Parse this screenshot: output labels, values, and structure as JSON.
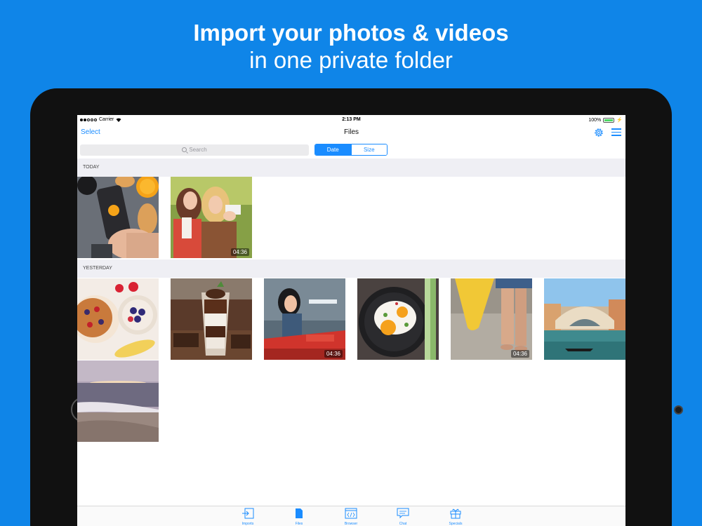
{
  "headline": {
    "line1": "Import your photos & videos",
    "line2": "in one private folder"
  },
  "status": {
    "carrier": "Carrier",
    "time": "2:13 PM",
    "battery": "100%"
  },
  "nav": {
    "select": "Select",
    "title": "Files",
    "icons": [
      "gear-icon",
      "menu-icon"
    ]
  },
  "search": {
    "placeholder": "Search"
  },
  "sort": {
    "date": "Date",
    "size": "Size",
    "selected": "Date"
  },
  "sections": [
    {
      "title": "TODAY",
      "items": [
        {
          "subject": "hand holding phone over breakfast"
        },
        {
          "subject": "two women taking a selfie",
          "duration": "04:36"
        }
      ]
    },
    {
      "title": "YESTERDAY",
      "items": [
        {
          "subject": "granola bowls with berries and bananas"
        },
        {
          "subject": "chocolate parfait dessert"
        },
        {
          "subject": "woman leaning on red car",
          "duration": "04:36"
        },
        {
          "subject": "fried eggs in a pan"
        },
        {
          "subject": "legs with surfboard on beach",
          "duration": "04:36"
        },
        {
          "subject": "Venice Rialto bridge"
        },
        {
          "subject": "beach sunset with waves"
        }
      ]
    }
  ],
  "tabs": [
    {
      "label": "Imports",
      "icon": "import-icon"
    },
    {
      "label": "Files",
      "icon": "file-icon"
    },
    {
      "label": "Browser",
      "icon": "browser-icon"
    },
    {
      "label": "Chat",
      "icon": "chat-icon"
    },
    {
      "label": "Specials",
      "icon": "gift-icon"
    }
  ],
  "colors": {
    "background": "#0f85e8",
    "accent": "#1a8cff",
    "battery": "#4cd964"
  }
}
